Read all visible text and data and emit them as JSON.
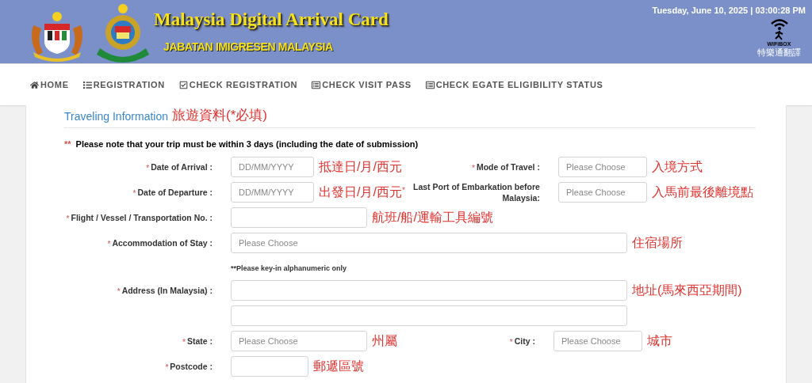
{
  "header": {
    "title": "Malaysia Digital Arrival Card",
    "subtitle": "JABATAN IMIGRESEN MALAYSIA",
    "datetime": "Tuesday, June 10, 2025 | 03:00:28 PM",
    "badge_brand": "WiFiBOX",
    "badge_caption": "特樂通翻譯"
  },
  "nav": [
    {
      "label": "HOME",
      "kind": "home"
    },
    {
      "label": "REGISTRATION",
      "kind": "list"
    },
    {
      "label": "CHECK REGISTRATION",
      "kind": "check"
    },
    {
      "label": "CHECK VISIT PASS",
      "kind": "doc"
    },
    {
      "label": "CHECK EGATE ELIGIBILITY STATUS",
      "kind": "doc"
    }
  ],
  "section": {
    "title": "Traveling Information",
    "annotation": "旅遊資料(*必填)"
  },
  "note": {
    "marker": "**",
    "text": "Please note that your trip must be within 3 days (including the date of submission)"
  },
  "rows": [
    {
      "fields": [
        {
          "required": "*",
          "label": "Date of Arrival :",
          "placeholder": "DD/MM/YYYY",
          "kind": "date",
          "annotation": "抵達日/月/西元"
        },
        {
          "required": "*",
          "label": "Mode of Travel :",
          "placeholder": "Please Choose",
          "kind": "small",
          "annotation": "入境方式"
        }
      ]
    },
    {
      "fields": [
        {
          "required": "*",
          "label": "Date of Departure :",
          "placeholder": "DD/MM/YYYY",
          "kind": "date",
          "annotation": "出發日/月/西元"
        },
        {
          "required": "*",
          "label": "Last Port of Embarkation before Malaysia:",
          "placeholder": "Please Choose",
          "kind": "small",
          "annotation": "入馬前最後離境點"
        }
      ]
    },
    {
      "fields": [
        {
          "required": "*",
          "label": "Flight / Vessel / Transportation No. :",
          "kind": "medium",
          "annotation": "航班/船/運輸工具編號"
        }
      ]
    },
    {
      "fields": [
        {
          "required": "*",
          "label": "Accommodation of Stay :",
          "placeholder": "Please Choose",
          "kind": "wide",
          "annotation": "住宿場所"
        }
      ]
    },
    {
      "hint": "**Please key-in alphanumeric only"
    },
    {
      "fields": [
        {
          "required": "*",
          "label": "Address (In Malaysia) :",
          "kind": "wide",
          "annotation": "地址(馬來西亞期間)"
        }
      ]
    },
    {
      "fields": [
        {
          "kind": "wide"
        }
      ]
    },
    {
      "fields": [
        {
          "required": "*",
          "label": "State :",
          "placeholder": "Please Choose",
          "kind": "medium",
          "annotation": "州屬"
        },
        {
          "required": "*",
          "label": "City :",
          "placeholder": "Please Choose",
          "kind": "small",
          "annotation": "城市"
        }
      ]
    },
    {
      "fields": [
        {
          "required": "*",
          "label": "Postcode :",
          "kind": "tiny",
          "annotation": "郵遞區號"
        }
      ]
    }
  ]
}
